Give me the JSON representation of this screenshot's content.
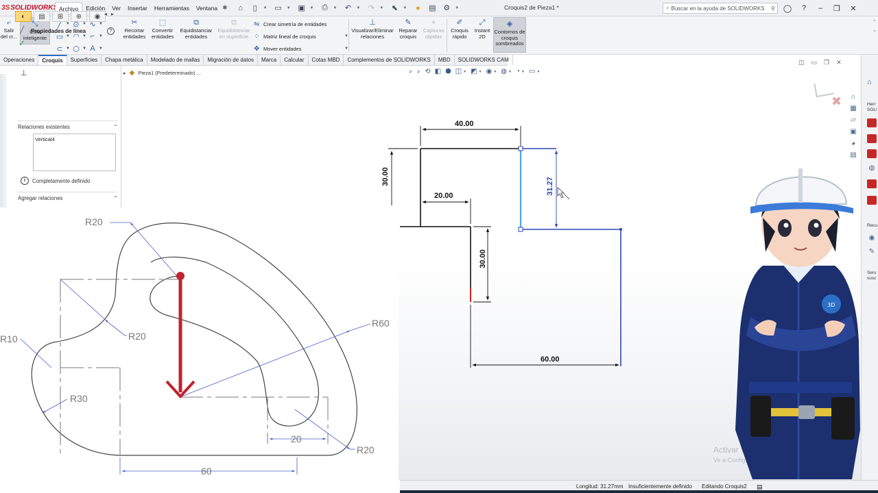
{
  "app": {
    "brand": "SOLIDWORKS",
    "document_title": "Croquis2 de Pieza1 *",
    "menu": [
      "Archivo",
      "Edición",
      "Ver",
      "Insertar",
      "Herramientas",
      "Ventana"
    ],
    "help_search_placeholder": "Buscar en la ayuda de SOLIDWORKS"
  },
  "ribbon": {
    "exit_sketch": "Salir del cr...",
    "smart_dimension": "Cota inteligente",
    "trim": "Recortar entidades",
    "convert": "Convertir entidades",
    "offset": "Equidistanciar entidades",
    "offset_surface": "Equidistanciar en superficie",
    "mirror": "Crear simetría de entidades",
    "linear_pattern": "Matriz lineal de croquis",
    "move": "Mover entidades",
    "relations": "Visualizar/Eliminar relaciones",
    "repair": "Reparar croquis",
    "quick_snaps": "Capturas rápidas",
    "rapid_sketch": "Croquis rápido",
    "instant2d": "Instant 2D",
    "shaded_contours": "Contornos de croquis sombreados"
  },
  "tabs": [
    "Operaciones",
    "Croquis",
    "Superficies",
    "Chapa metálica",
    "Modelado de mallas",
    "Migración de datos",
    "Marca",
    "Calcular",
    "Cotas MBD",
    "Complementos de SOLIDWORKS",
    "MBD",
    "SOLIDWORKS CAM"
  ],
  "active_tab": "Croquis",
  "tree": {
    "part": "Pieza1 (Predeterminado) ..."
  },
  "property_manager": {
    "title": "Propiedades de línea",
    "existing_relations_label": "Relaciones existentes",
    "relations": [
      "Vertical4"
    ],
    "status": "Completamente definido",
    "add_relations_label": "Agregar relaciones"
  },
  "sketch": {
    "dims": {
      "top_width": "40.00",
      "left_height": "30.00",
      "step_width": "20.00",
      "step_height": "30.00",
      "selected_height": "31.27",
      "bottom_width": "60.00"
    }
  },
  "reference_drawing": {
    "labels": [
      "R20",
      "R20",
      "R10",
      "R30",
      "R60",
      "20",
      "R20",
      "60"
    ]
  },
  "task_pane": {
    "labels": [
      "Herr SOLI",
      "Recu",
      "Serv susc"
    ]
  },
  "statusbar": {
    "length": "Longitud: 31.27mm",
    "definition": "Insuficientemente definido",
    "editing": "Editando Croquis2"
  },
  "watermark": {
    "line1": "Activar Win",
    "line2": "Ve a Configurac"
  },
  "colors": {
    "sketch_blue": "#2b45b5",
    "selected_line": "#4aa6e8",
    "ref_arrow": "#c0242e",
    "active_tab_accent": "#2f6fc8"
  }
}
